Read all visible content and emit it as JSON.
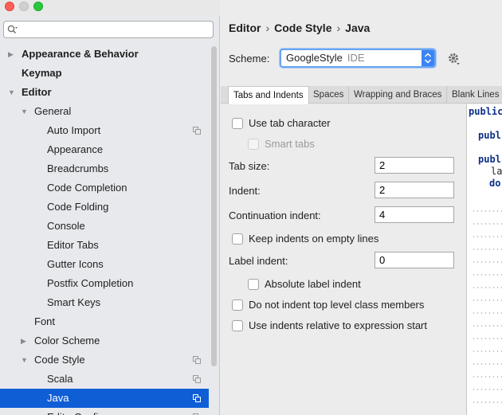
{
  "search": {
    "placeholder": "",
    "icon": "search-icon"
  },
  "tree": {
    "appearance_behavior": "Appearance & Behavior",
    "keymap": "Keymap",
    "editor": "Editor",
    "general": "General",
    "auto_import": "Auto Import",
    "appearance": "Appearance",
    "breadcrumbs": "Breadcrumbs",
    "code_completion": "Code Completion",
    "code_folding": "Code Folding",
    "console": "Console",
    "editor_tabs": "Editor Tabs",
    "gutter_icons": "Gutter Icons",
    "postfix_completion": "Postfix Completion",
    "smart_keys": "Smart Keys",
    "font": "Font",
    "color_scheme": "Color Scheme",
    "code_style": "Code Style",
    "scala": "Scala",
    "java": "Java",
    "editor_config": "EditorConfig"
  },
  "breadcrumb": {
    "part1": "Editor",
    "part2": "Code Style",
    "part3": "Java",
    "separator": "›"
  },
  "scheme": {
    "label": "Scheme:",
    "value": "GoogleStyle",
    "sub": "IDE"
  },
  "tabs": {
    "tabs_indents": "Tabs and Indents",
    "spaces": "Spaces",
    "wrapping": "Wrapping and Braces",
    "blank_lines": "Blank Lines"
  },
  "form": {
    "use_tab_character": "Use tab character",
    "smart_tabs": "Smart tabs",
    "tab_size_label": "Tab size:",
    "tab_size": "2",
    "indent_label": "Indent:",
    "indent": "2",
    "continuation_label": "Continuation indent:",
    "continuation": "4",
    "keep_indents": "Keep indents on empty lines",
    "label_indent_label": "Label indent:",
    "label_indent": "0",
    "absolute_label_indent": "Absolute label indent",
    "no_indent_top_level": "Do not indent top level class members",
    "indents_relative": "Use indents relative to expression start"
  },
  "preview": {
    "line1": "public",
    "line2": "publ",
    "line3": "publ",
    "line4": "la",
    "line5": "do"
  },
  "colors": {
    "selection": "#0f5ed6",
    "accent": "#3b84f4"
  }
}
